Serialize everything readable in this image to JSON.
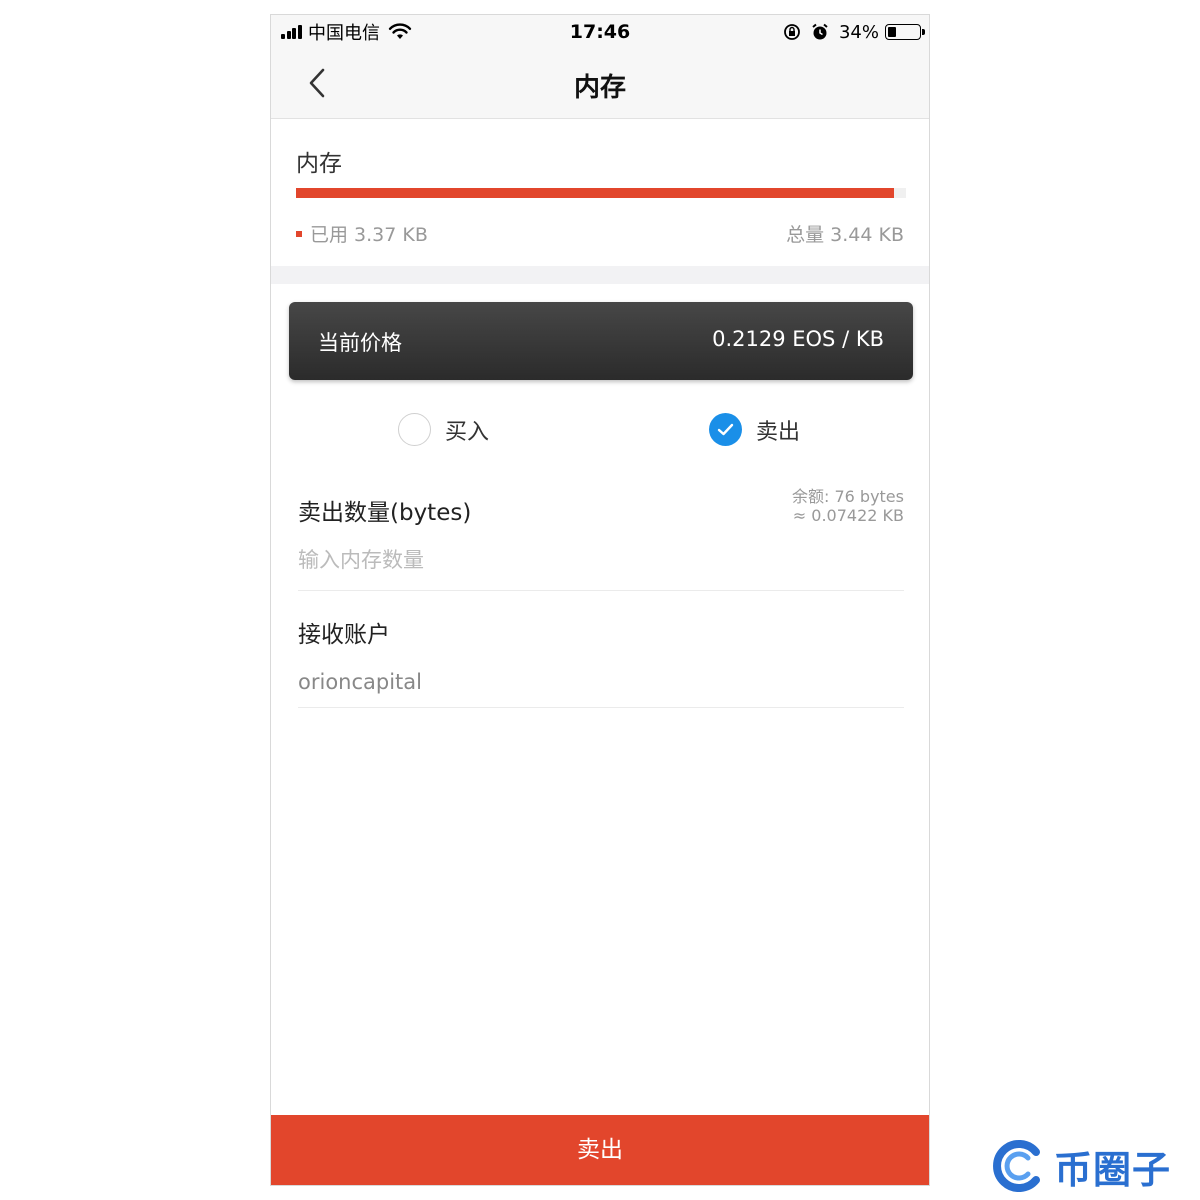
{
  "status_bar": {
    "carrier": "中国电信",
    "time": "17:46",
    "battery_text": "34%",
    "battery_level": 0.34
  },
  "nav": {
    "title": "内存"
  },
  "memory": {
    "title": "内存",
    "used_label": "已用 3.37 KB",
    "total_label": "总量 3.44 KB",
    "used_fraction": 0.98
  },
  "price": {
    "label": "当前价格",
    "value": "0.2129 EOS / KB"
  },
  "trade_mode": {
    "buy_label": "买入",
    "sell_label": "卖出",
    "selected": "sell"
  },
  "sell_amount": {
    "label": "卖出数量(bytes)",
    "balance_line1": "余额: 76 bytes",
    "balance_line2": "≈ 0.07422 KB",
    "placeholder": "输入内存数量",
    "value": ""
  },
  "receiver": {
    "label": "接收账户",
    "value": "orioncapital"
  },
  "submit": {
    "label": "卖出"
  },
  "watermark": {
    "text": "币圈子"
  },
  "colors": {
    "accent": "#e2462c",
    "check": "#1a8fe8",
    "price_card": "#333333"
  }
}
